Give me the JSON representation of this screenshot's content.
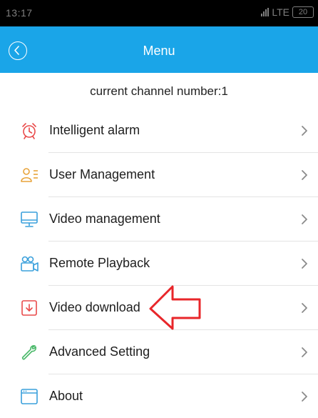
{
  "status_bar": {
    "time": "13:17",
    "network": "LTE",
    "battery": "20"
  },
  "header": {
    "title": "Menu"
  },
  "channel": {
    "text": "current channel number:1"
  },
  "menu": {
    "items": [
      {
        "label": "Intelligent alarm",
        "icon": "alarm-clock-icon",
        "color": "#e94a4a"
      },
      {
        "label": "User Management",
        "icon": "user-list-icon",
        "color": "#e8a33a"
      },
      {
        "label": "Video management",
        "icon": "monitor-icon",
        "color": "#3aa0dc"
      },
      {
        "label": "Remote Playback",
        "icon": "video-camera-icon",
        "color": "#3aa0dc"
      },
      {
        "label": "Video download",
        "icon": "download-icon",
        "color": "#e94a4a"
      },
      {
        "label": "Advanced Setting",
        "icon": "wrench-icon",
        "color": "#4bb96a"
      },
      {
        "label": "About",
        "icon": "window-icon",
        "color": "#3aa0dc"
      }
    ]
  },
  "colors": {
    "accent": "#1aa5e8",
    "annotation": "#e8262a"
  }
}
